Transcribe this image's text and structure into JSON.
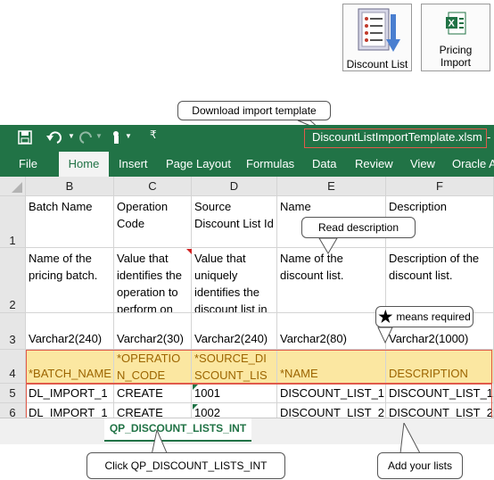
{
  "toolbar": {
    "discount_list_label": "Discount List",
    "pricing_import_label": "Pricing Import"
  },
  "callouts": {
    "download": "Download  import template",
    "read_description": "Read description",
    "means_required": "means required",
    "click_tab": "Click QP_DISCOUNT_LISTS_INT",
    "add_lists": "Add your lists"
  },
  "excel": {
    "filename": "DiscountListImportTemplate.xlsm",
    "title_dash": "-",
    "tabs": [
      "File",
      "Home",
      "Insert",
      "Page Layout",
      "Formulas",
      "Data",
      "Review",
      "View",
      "Oracle A"
    ],
    "active_tab": "Home",
    "sheet_tab": "QP_DISCOUNT_LISTS_INT",
    "colors": {
      "excel_green": "#217346",
      "header_yellow": "#fbe7a1",
      "callout_red": "#e05a4a"
    }
  },
  "sheet": {
    "columns": [
      "B",
      "C",
      "D",
      "E",
      "F"
    ],
    "row_numbers": [
      "1",
      "2",
      "3",
      "4",
      "5",
      "6"
    ],
    "rows": [
      [
        "Batch Name",
        "Operation Code",
        "Source Discount List Id",
        "Name",
        "Description"
      ],
      [
        "Name of the pricing batch.",
        "Value that identifies the operation to perform on",
        "Value that uniquely identifies the discount list in",
        "Name of the discount list.",
        "Description of the discount list."
      ],
      [
        "Varchar2(240)",
        "Varchar2(30)",
        "Varchar2(240)",
        "Varchar2(80)",
        "Varchar2(1000)"
      ],
      [
        "*BATCH_NAME",
        "*OPERATION_CODE",
        "*SOURCE_DISCOUNT_LIST_ID",
        "*NAME",
        "DESCRIPTION"
      ],
      [
        "DL_IMPORT_1",
        "CREATE",
        "1001",
        "DISCOUNT_LIST_1",
        "DISCOUNT_LIST_1"
      ],
      [
        "DL_IMPORT_1",
        "CREATE",
        "1002",
        "DISCOUNT_LIST_2",
        "DISCOUNT_LIST_2"
      ]
    ]
  }
}
